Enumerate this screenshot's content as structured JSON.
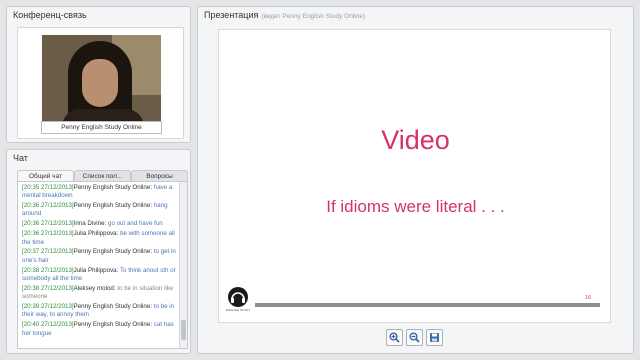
{
  "conference": {
    "title": "Конференц-связь",
    "video_label": "Penny English Study Online"
  },
  "chat": {
    "title": "Чат",
    "tabs": [
      {
        "label": "Общий чат",
        "active": true
      },
      {
        "label": "Список пол...",
        "active": false
      },
      {
        "label": "Вопросы",
        "active": false
      }
    ],
    "messages": [
      {
        "time": "[20:35 27/12/2013]",
        "name": "Penny English Study Online:",
        "text": "have a mental breakdown"
      },
      {
        "time": "[20:36 27/12/2013]",
        "name": "Penny English Study Online:",
        "text": "hang around"
      },
      {
        "time": "[20:36 27/12/2013]",
        "name": "Irina Divine:",
        "text": "go out and have fun"
      },
      {
        "time": "[20:36 27/12/2013]",
        "name": "Julia Philippova:",
        "text": "be with someone all the time"
      },
      {
        "time": "[20:37 27/12/2013]",
        "name": "Penny English Study Online:",
        "text": "to get in one's hair"
      },
      {
        "time": "[20:38 27/12/2013]",
        "name": "Julia Philippova:",
        "text": "To think anout sth or somebody all the time"
      },
      {
        "time": "[20:38 27/12/2013]",
        "name": "Aleksey molod:",
        "text": "to be in situation like someone",
        "grey": true
      },
      {
        "time": "[20:39 27/12/2013]",
        "name": "Penny English Study Online:",
        "text": "to be in their way, to annoy them"
      },
      {
        "time": "[20:40 27/12/2013]",
        "name": "Penny English Study Online:",
        "text": "cat has her tongue"
      }
    ]
  },
  "presentation": {
    "title": "Презентация",
    "subtitle": "(ведет Penny English Study Online)",
    "slide": {
      "title": "Video",
      "subtitle": "If idioms were literal . . .",
      "logo_text": "ENGLISH STUDY",
      "page_number": "16"
    },
    "toolbar": [
      {
        "icon": "zoom-in-icon"
      },
      {
        "icon": "zoom-out-icon"
      },
      {
        "icon": "save-icon"
      }
    ]
  },
  "colors": {
    "slide_accent": "#d4326e",
    "chat_timestamp": "#2e8c3d",
    "chat_text": "#4f76b8"
  }
}
